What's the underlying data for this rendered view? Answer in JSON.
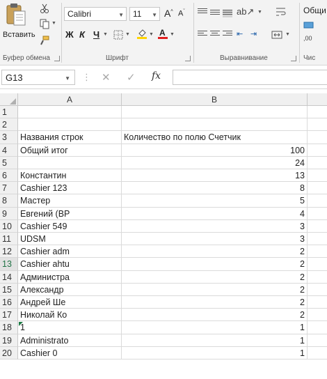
{
  "ribbon": {
    "clipboard": {
      "paste_label": "Вставить",
      "group_label": "Буфер обмена"
    },
    "font": {
      "font_name": "Calibri",
      "font_size": "11",
      "bold": "Ж",
      "italic": "К",
      "underline": "Ч",
      "group_label": "Шрифт"
    },
    "alignment": {
      "group_label": "Выравнивание"
    },
    "number": {
      "format_value": "Общи",
      "group_label": "Чис"
    }
  },
  "formula_bar": {
    "cell_ref": "G13",
    "fx": "fx",
    "cancel": "✕",
    "enter": "✓",
    "content": ""
  },
  "grid": {
    "columns": [
      "A",
      "B"
    ],
    "rows": [
      {
        "n": "1",
        "a": "",
        "b": ""
      },
      {
        "n": "2",
        "a": "",
        "b": ""
      },
      {
        "n": "3",
        "a": "Названия строк",
        "b": "Количество по полю Счетчик"
      },
      {
        "n": "4",
        "a": "Общий итог",
        "b": "100"
      },
      {
        "n": "5",
        "a": "",
        "b": "24"
      },
      {
        "n": "6",
        "a": "Константин",
        "b": "13"
      },
      {
        "n": "7",
        "a": "Cashier 123",
        "b": "8"
      },
      {
        "n": "8",
        "a": "Мастер",
        "b": "5"
      },
      {
        "n": "9",
        "a": "Евгений (ВР",
        "b": "4"
      },
      {
        "n": "10",
        "a": "Cashier 549",
        "b": "3"
      },
      {
        "n": "11",
        "a": "UDSM",
        "b": "3"
      },
      {
        "n": "12",
        "a": "Cashier adm",
        "b": "2"
      },
      {
        "n": "13",
        "a": "Cashier ahtu",
        "b": "2"
      },
      {
        "n": "14",
        "a": "Администра",
        "b": "2"
      },
      {
        "n": "15",
        "a": "Александр",
        "b": "2"
      },
      {
        "n": "16",
        "a": "Андрей Ше",
        "b": "2"
      },
      {
        "n": "17",
        "a": "Николай Ко",
        "b": "2"
      },
      {
        "n": "18",
        "a": "1",
        "b": "1"
      },
      {
        "n": "19",
        "a": "Administrato",
        "b": "1"
      },
      {
        "n": "20",
        "a": "Cashier 0",
        "b": "1"
      }
    ]
  }
}
